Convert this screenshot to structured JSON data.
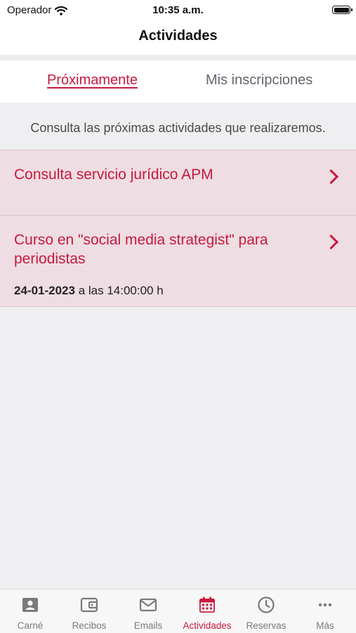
{
  "status_bar": {
    "carrier": "Operador",
    "time": "10:35 a.m."
  },
  "nav": {
    "title": "Actividades"
  },
  "tabs": [
    {
      "label": "Próximamente",
      "active": true
    },
    {
      "label": "Mis inscripciones",
      "active": false
    }
  ],
  "intro": "Consulta las próximas actividades que realizaremos.",
  "activities": [
    {
      "title": "Consulta servicio jurídico APM"
    },
    {
      "title": "Curso en \"social media strategist\" para periodistas",
      "date": "24-01-2023",
      "time_text": "a las 14:00:00 h"
    }
  ],
  "tabbar": [
    {
      "label": "Carné",
      "icon": "id-card-icon",
      "active": false
    },
    {
      "label": "Recibos",
      "icon": "wallet-icon",
      "active": false
    },
    {
      "label": "Emails",
      "icon": "envelope-icon",
      "active": false
    },
    {
      "label": "Actividades",
      "icon": "calendar-icon",
      "active": true
    },
    {
      "label": "Reservas",
      "icon": "clock-icon",
      "active": false
    },
    {
      "label": "Más",
      "icon": "more-icon",
      "active": false
    }
  ],
  "colors": {
    "accent": "#c8193e",
    "card_bg": "#eedde2",
    "background": "#efeff1"
  }
}
